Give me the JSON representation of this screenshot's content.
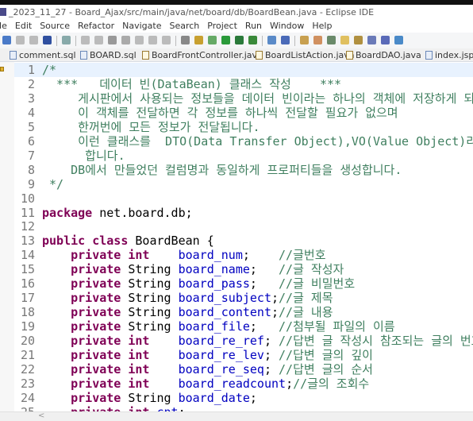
{
  "window": {
    "title": "_2023_11_27 - Board_Ajax/src/main/java/net/board/db/BoardBean.java - Eclipse IDE"
  },
  "menu": [
    "ile",
    "Edit",
    "Source",
    "Refactor",
    "Navigate",
    "Search",
    "Project",
    "Run",
    "Window",
    "Help"
  ],
  "tabs": [
    {
      "label": "comment.sql",
      "type": "sql"
    },
    {
      "label": "BOARD.sql",
      "type": "sql"
    },
    {
      "label": "BoardFrontController.java",
      "type": "java"
    },
    {
      "label": "BoardListAction.java",
      "type": "java"
    },
    {
      "label": "BoardDAO.java",
      "type": "java"
    },
    {
      "label": "index.jsp",
      "type": "jsp"
    }
  ],
  "colors": {
    "comment": "#3f7f5f",
    "keyword": "#7f0055",
    "field": "#0000c0",
    "current_line": "#e8f2fe"
  },
  "editor": {
    "current_line": 1,
    "lines": [
      {
        "n": "1",
        "seg": [
          [
            "/*",
            "cm"
          ]
        ]
      },
      {
        "n": "2",
        "seg": [
          [
            "  ***   데이터 빈(DataBean) 클래스 작성    ***",
            "cm"
          ]
        ]
      },
      {
        "n": "3",
        "seg": [
          [
            "     게시판에서 사용되는 정보들을 데이터 빈이라는 하나의 객체에 저장하게 되고",
            "cm"
          ]
        ]
      },
      {
        "n": "4",
        "seg": [
          [
            "     이 객체를 전달하면 각 정보를 하나씩 전달할 필요가 없으며",
            "cm"
          ]
        ]
      },
      {
        "n": "5",
        "seg": [
          [
            "     한꺼번에 모든 정보가 전달됩니다.",
            "cm"
          ]
        ]
      },
      {
        "n": "6",
        "seg": [
          [
            "     이런 클래스를  DTO(Data Transfer Object),VO(Value Object)라고",
            "cm"
          ]
        ]
      },
      {
        "n": "7",
        "seg": [
          [
            "      합니다.",
            "cm"
          ]
        ]
      },
      {
        "n": "8",
        "seg": [
          [
            "    DB에서 만들었던 컬럼명과 동일하게 프로퍼티들을 생성합니다.",
            "cm"
          ]
        ]
      },
      {
        "n": "9",
        "seg": [
          [
            " */",
            "cm"
          ]
        ]
      },
      {
        "n": "10",
        "seg": []
      },
      {
        "n": "11",
        "seg": [
          [
            "package",
            "kw"
          ],
          [
            " net.board.db;",
            "pl"
          ]
        ]
      },
      {
        "n": "12",
        "seg": []
      },
      {
        "n": "13",
        "seg": [
          [
            "public class",
            "kw"
          ],
          [
            " BoardBean {",
            "pl"
          ]
        ]
      },
      {
        "n": "14",
        "seg": [
          [
            "    ",
            "pl"
          ],
          [
            "private int",
            "kw"
          ],
          [
            "    ",
            "pl"
          ],
          [
            "board_num",
            "fd"
          ],
          [
            ";    ",
            "pl"
          ],
          [
            "//글번호",
            "cm"
          ]
        ]
      },
      {
        "n": "15",
        "seg": [
          [
            "    ",
            "pl"
          ],
          [
            "private",
            "kw"
          ],
          [
            " String ",
            "pl"
          ],
          [
            "board_name",
            "fd"
          ],
          [
            ";   ",
            "pl"
          ],
          [
            "//글 작성자",
            "cm"
          ]
        ]
      },
      {
        "n": "16",
        "seg": [
          [
            "    ",
            "pl"
          ],
          [
            "private",
            "kw"
          ],
          [
            " String ",
            "pl"
          ],
          [
            "board_pass",
            "fd"
          ],
          [
            ";   ",
            "pl"
          ],
          [
            "//글 비밀번호",
            "cm"
          ]
        ]
      },
      {
        "n": "17",
        "seg": [
          [
            "    ",
            "pl"
          ],
          [
            "private",
            "kw"
          ],
          [
            " String ",
            "pl"
          ],
          [
            "board_subject",
            "fd"
          ],
          [
            ";",
            "pl"
          ],
          [
            "//글 제목",
            "cm"
          ]
        ]
      },
      {
        "n": "18",
        "seg": [
          [
            "    ",
            "pl"
          ],
          [
            "private",
            "kw"
          ],
          [
            " String ",
            "pl"
          ],
          [
            "board_content",
            "fd"
          ],
          [
            ";",
            "pl"
          ],
          [
            "//글 내용",
            "cm"
          ]
        ]
      },
      {
        "n": "19",
        "seg": [
          [
            "    ",
            "pl"
          ],
          [
            "private",
            "kw"
          ],
          [
            " String ",
            "pl"
          ],
          [
            "board_file",
            "fd"
          ],
          [
            ";   ",
            "pl"
          ],
          [
            "//첨부될 파일의 이름",
            "cm"
          ]
        ]
      },
      {
        "n": "20",
        "seg": [
          [
            "    ",
            "pl"
          ],
          [
            "private int",
            "kw"
          ],
          [
            "    ",
            "pl"
          ],
          [
            "board_re_ref",
            "fd"
          ],
          [
            "; ",
            "pl"
          ],
          [
            "//답변 글 작성시 참조되는 글의 번호",
            "cm"
          ]
        ]
      },
      {
        "n": "21",
        "seg": [
          [
            "    ",
            "pl"
          ],
          [
            "private int",
            "kw"
          ],
          [
            "    ",
            "pl"
          ],
          [
            "board_re_lev",
            "fd"
          ],
          [
            "; ",
            "pl"
          ],
          [
            "//답변 글의 깊이",
            "cm"
          ]
        ]
      },
      {
        "n": "22",
        "seg": [
          [
            "    ",
            "pl"
          ],
          [
            "private int",
            "kw"
          ],
          [
            "    ",
            "pl"
          ],
          [
            "board_re_seq",
            "fd"
          ],
          [
            "; ",
            "pl"
          ],
          [
            "//답변 글의 순서",
            "cm"
          ]
        ]
      },
      {
        "n": "23",
        "seg": [
          [
            "    ",
            "pl"
          ],
          [
            "private int",
            "kw"
          ],
          [
            "    ",
            "pl"
          ],
          [
            "board_readcount",
            "fd"
          ],
          [
            ";",
            "pl"
          ],
          [
            "//글의 조회수",
            "cm"
          ]
        ]
      },
      {
        "n": "24",
        "seg": [
          [
            "    ",
            "pl"
          ],
          [
            "private",
            "kw"
          ],
          [
            " String ",
            "pl"
          ],
          [
            "board_date",
            "fd"
          ],
          [
            ";",
            "pl"
          ]
        ]
      },
      {
        "n": "25",
        "seg": [
          [
            "    ",
            "pl"
          ],
          [
            "private int",
            "kw"
          ],
          [
            " ",
            "pl"
          ],
          [
            "cnt",
            "fd"
          ],
          [
            ";",
            "pl"
          ]
        ]
      }
    ]
  },
  "scrollbar": {
    "left_arrow": "<"
  }
}
